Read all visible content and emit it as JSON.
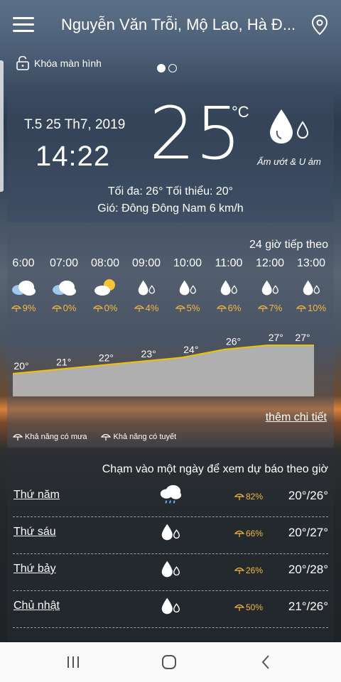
{
  "header": {
    "location": "Nguyễn Văn Trỗi, Mộ Lao, Hà Đ...",
    "lock_label": "Khóa màn hình"
  },
  "current": {
    "date": "T.5 25 Th7, 2019",
    "time": "14:22",
    "temperature": "25",
    "unit": "°C",
    "condition": "Ẩm ướt & U ám",
    "minmax": "Tối đa: 26°  Tối thiểu: 20°",
    "wind": "Gió: Đông Đông Nam 6 km/h"
  },
  "hourly": {
    "title": "24 giờ tiếp theo",
    "items": [
      {
        "time": "6:00",
        "icon": "partly-cloudy-icon",
        "precip": "9%"
      },
      {
        "time": "07:00",
        "icon": "partly-cloudy-icon",
        "precip": "0%"
      },
      {
        "time": "08:00",
        "icon": "sun-cloud-icon",
        "precip": "0%"
      },
      {
        "time": "09:00",
        "icon": "raindrops-icon",
        "precip": "4%"
      },
      {
        "time": "10:00",
        "icon": "raindrops-icon",
        "precip": "5%"
      },
      {
        "time": "11:00",
        "icon": "raindrops-icon",
        "precip": "6%"
      },
      {
        "time": "12:00",
        "icon": "raindrops-icon",
        "precip": "7%"
      },
      {
        "time": "13:00",
        "icon": "raindrops-icon",
        "precip": "10%"
      }
    ],
    "more_label": "thêm chi tiết",
    "legend_rain": "Khả năng có mưa",
    "legend_snow": "Khả năng có tuyết"
  },
  "chart_data": {
    "type": "area",
    "categories": [
      "6:00",
      "07:00",
      "08:00",
      "09:00",
      "10:00",
      "11:00",
      "12:00",
      "13:00"
    ],
    "values": [
      20,
      21,
      22,
      23,
      24,
      26,
      27,
      27
    ],
    "labels": [
      "20°",
      "21°",
      "22°",
      "23°",
      "24°",
      "26°",
      "27°",
      "27°"
    ],
    "line_color": "#f2c200",
    "fill_color": "#bfbfbf"
  },
  "daily": {
    "title": "Chạm vào một ngày để xem dự báo theo giờ",
    "items": [
      {
        "day": "Thứ năm",
        "icon": "rain-cloud-icon",
        "precip": "82%",
        "range": "20°/26°"
      },
      {
        "day": "Thứ sáu",
        "icon": "raindrops-icon",
        "precip": "66%",
        "range": "20°/27°"
      },
      {
        "day": "Thứ bảy",
        "icon": "raindrops-icon",
        "precip": "26%",
        "range": "20°/28°"
      },
      {
        "day": "Chủ nhật",
        "icon": "raindrops-icon",
        "precip": "50%",
        "range": "21°/26°"
      }
    ]
  },
  "colors": {
    "accent_orange": "#f5b940",
    "chart_line": "#f2c200",
    "nav_bg": "#fafafa"
  }
}
